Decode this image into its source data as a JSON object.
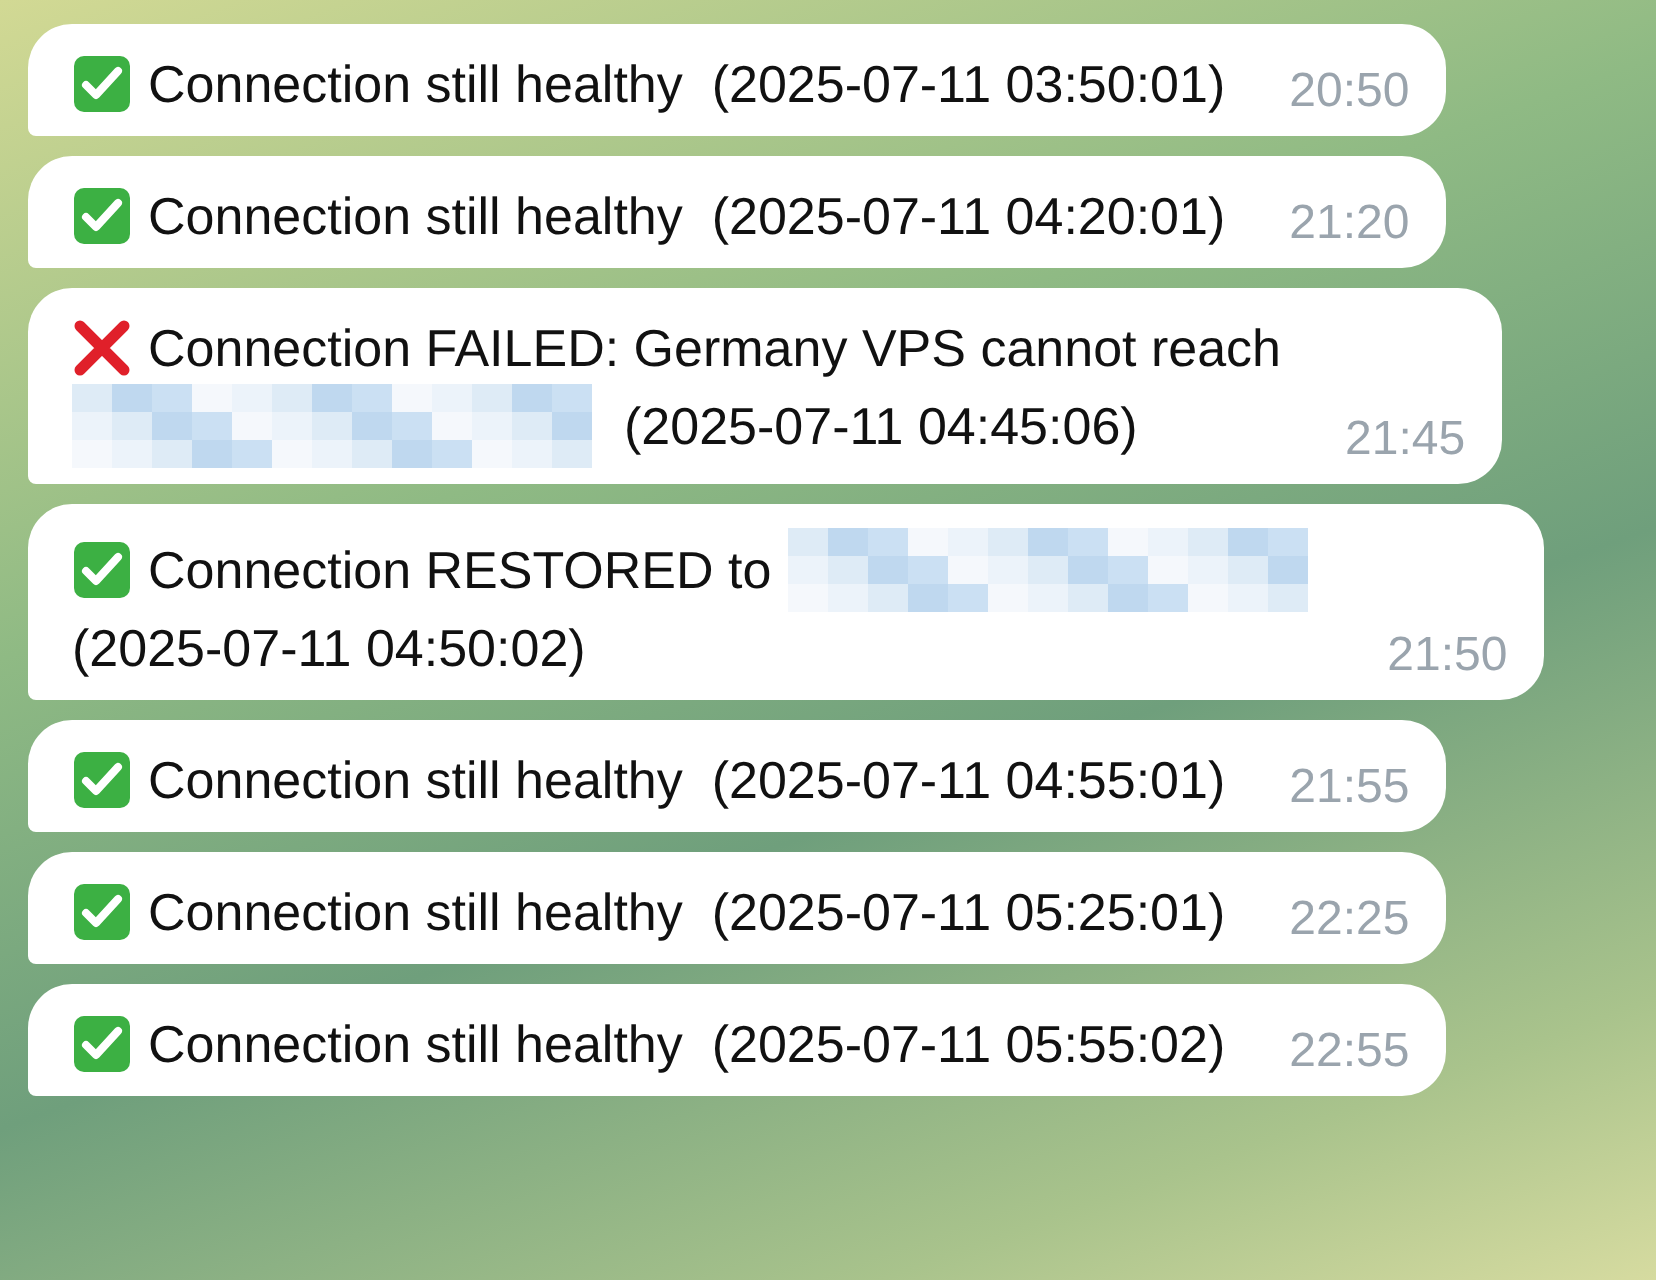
{
  "messages": [
    {
      "kind": "success",
      "lines": [
        [
          {
            "kind": "text",
            "text": "Connection still healthy  (2025-07-11 03:50:01)"
          }
        ]
      ],
      "time": "20:50"
    },
    {
      "kind": "success",
      "lines": [
        [
          {
            "kind": "text",
            "text": "Connection still healthy  (2025-07-11 04:20:01)"
          }
        ]
      ],
      "time": "21:20"
    },
    {
      "kind": "failure",
      "lines": [
        [
          {
            "kind": "text",
            "text": "Connection FAILED: Germany VPS cannot reach"
          }
        ],
        [
          {
            "kind": "redacted"
          },
          {
            "kind": "text",
            "text": "(2025-07-11 04:45:06)"
          }
        ]
      ],
      "time": "21:45"
    },
    {
      "kind": "success",
      "lines": [
        [
          {
            "kind": "text",
            "text": "Connection RESTORED to"
          },
          {
            "kind": "redacted"
          }
        ],
        [
          {
            "kind": "text",
            "text": "(2025-07-11 04:50:02)"
          }
        ]
      ],
      "time": "21:50"
    },
    {
      "kind": "success",
      "lines": [
        [
          {
            "kind": "text",
            "text": "Connection still healthy  (2025-07-11 04:55:01)"
          }
        ]
      ],
      "time": "21:55"
    },
    {
      "kind": "success",
      "lines": [
        [
          {
            "kind": "text",
            "text": "Connection still healthy  (2025-07-11 05:25:01)"
          }
        ]
      ],
      "time": "22:25"
    },
    {
      "kind": "success",
      "lines": [
        [
          {
            "kind": "text",
            "text": "Connection still healthy  (2025-07-11 05:55:02)"
          }
        ]
      ],
      "time": "22:55"
    }
  ]
}
